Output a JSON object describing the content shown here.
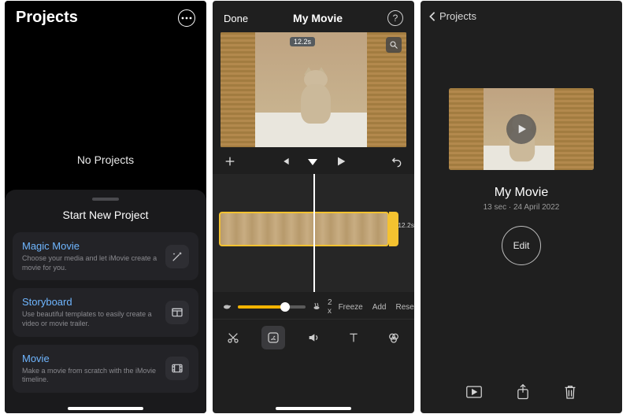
{
  "panel1": {
    "title": "Projects",
    "empty_text": "No Projects",
    "sheet_title": "Start New Project",
    "cards": [
      {
        "title": "Magic Movie",
        "sub": "Choose your media and let iMovie create a movie for you."
      },
      {
        "title": "Storyboard",
        "sub": "Use beautiful templates to easily create a video or movie trailer."
      },
      {
        "title": "Movie",
        "sub": "Make a movie from scratch with the iMovie timeline."
      }
    ]
  },
  "panel2": {
    "done": "Done",
    "title": "My Movie",
    "help_glyph": "?",
    "preview_badge": "12.2s",
    "clip_time": "12.2s",
    "speed": {
      "multiplier": "2 x",
      "freeze": "Freeze",
      "add": "Add",
      "reset": "Reset"
    }
  },
  "panel3": {
    "back_label": "Projects",
    "movie_title": "My Movie",
    "meta": "13 sec · 24 April 2022",
    "edit_label": "Edit"
  }
}
